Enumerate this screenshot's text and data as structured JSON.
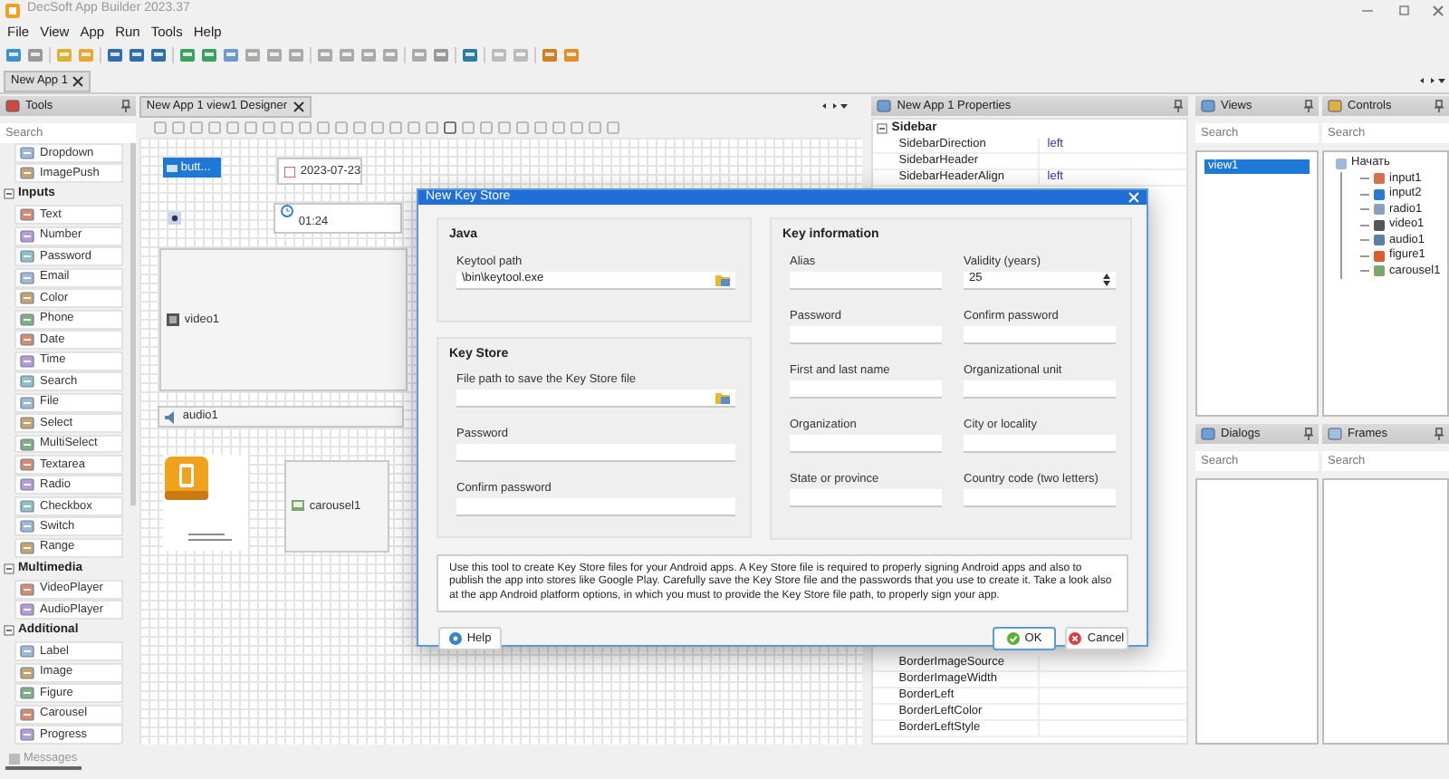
{
  "window": {
    "title": "DecSoft App Builder 2023.37"
  },
  "menu": [
    "File",
    "View",
    "App",
    "Run",
    "Tools",
    "Help"
  ],
  "document_tabs": [
    {
      "label": "New App 1",
      "selected": true
    }
  ],
  "tools_panel": {
    "title": "Tools",
    "search": {
      "placeholder": "Search"
    },
    "items": [
      {
        "kind": "item",
        "label": "Dropdown"
      },
      {
        "kind": "item",
        "label": "ImagePush"
      },
      {
        "kind": "group",
        "label": "Inputs",
        "expanded": true
      },
      {
        "kind": "item",
        "label": "Text"
      },
      {
        "kind": "item",
        "label": "Number"
      },
      {
        "kind": "item",
        "label": "Password"
      },
      {
        "kind": "item",
        "label": "Email"
      },
      {
        "kind": "item",
        "label": "Color"
      },
      {
        "kind": "item",
        "label": "Phone"
      },
      {
        "kind": "item",
        "label": "Date"
      },
      {
        "kind": "item",
        "label": "Time"
      },
      {
        "kind": "item",
        "label": "Search"
      },
      {
        "kind": "item",
        "label": "File"
      },
      {
        "kind": "item",
        "label": "Select"
      },
      {
        "kind": "item",
        "label": "MultiSelect"
      },
      {
        "kind": "item",
        "label": "Textarea"
      },
      {
        "kind": "item",
        "label": "Radio"
      },
      {
        "kind": "item",
        "label": "Checkbox"
      },
      {
        "kind": "item",
        "label": "Switch"
      },
      {
        "kind": "item",
        "label": "Range"
      },
      {
        "kind": "group",
        "label": "Multimedia",
        "expanded": true
      },
      {
        "kind": "item",
        "label": "VideoPlayer"
      },
      {
        "kind": "item",
        "label": "AudioPlayer"
      },
      {
        "kind": "group",
        "label": "Additional",
        "expanded": true
      },
      {
        "kind": "item",
        "label": "Label"
      },
      {
        "kind": "item",
        "label": "Image"
      },
      {
        "kind": "item",
        "label": "Figure"
      },
      {
        "kind": "item",
        "label": "Carousel"
      },
      {
        "kind": "item",
        "label": "Progress"
      }
    ]
  },
  "designer": {
    "tab": "New App 1 view1 Designer",
    "widgets": [
      {
        "kind": "button",
        "label": "butt...",
        "selected": true
      },
      {
        "kind": "date",
        "label": "2023-07-23"
      },
      {
        "kind": "radio"
      },
      {
        "kind": "time",
        "label": "01:24"
      },
      {
        "kind": "video",
        "label": "video1"
      },
      {
        "kind": "audio",
        "label": "audio1"
      },
      {
        "kind": "image"
      },
      {
        "kind": "carousel",
        "label": "carousel1"
      }
    ]
  },
  "properties": {
    "title": "New App 1 Properties",
    "group": {
      "label": "Sidebar",
      "expanded": true
    },
    "rows_top": [
      {
        "name": "SidebarDirection",
        "value": "left"
      },
      {
        "name": "SidebarHeader"
      },
      {
        "name": "SidebarHeaderAlign",
        "value": "left"
      }
    ],
    "rows_bottom": [
      {
        "name": "BorderImageSource"
      },
      {
        "name": "BorderImageWidth"
      },
      {
        "name": "BorderLeft"
      },
      {
        "name": "BorderLeftColor"
      },
      {
        "name": "BorderLeftStyle"
      }
    ]
  },
  "views": {
    "title": "Views",
    "search": {
      "placeholder": "Search"
    },
    "items": [
      {
        "label": "view1",
        "selected": true
      }
    ]
  },
  "controls": {
    "title": "Controls",
    "search": {
      "placeholder": "Search"
    },
    "tree": [
      {
        "label": "Начать",
        "kind": "view",
        "children": [
          {
            "label": "input1",
            "kind": "input"
          },
          {
            "label": "input2",
            "kind": "time"
          },
          {
            "label": "radio1",
            "kind": "radio"
          },
          {
            "label": "video1",
            "kind": "video"
          },
          {
            "label": "audio1",
            "kind": "audio"
          },
          {
            "label": "figure1",
            "kind": "figure"
          },
          {
            "label": "carousel1",
            "kind": "carousel"
          }
        ]
      }
    ]
  },
  "dialogs": {
    "title": "Dialogs",
    "search": {
      "placeholder": "Search"
    }
  },
  "frames": {
    "title": "Frames",
    "search": {
      "placeholder": "Search"
    }
  },
  "status_bar": {
    "tab": "Messages"
  },
  "dialog": {
    "title": "New Key Store",
    "java": {
      "title": "Java",
      "fields": [
        {
          "label": "Keytool path",
          "kind": "file",
          "value": "\\bin\\keytool.exe"
        }
      ]
    },
    "key_store": {
      "title": "Key Store",
      "fields": [
        {
          "label": "File path to save the Key Store file",
          "kind": "file"
        },
        {
          "label": "Password",
          "kind": "text"
        },
        {
          "label": "Confirm password",
          "kind": "text"
        }
      ]
    },
    "key_information": {
      "title": "Key information",
      "fields": [
        {
          "label": "Alias",
          "kind": "text"
        },
        {
          "label": "Validity (years)",
          "kind": "number",
          "value": "25"
        },
        {
          "label": "Password",
          "kind": "text"
        },
        {
          "label": "Confirm password",
          "kind": "text"
        },
        {
          "label": "First and last name",
          "kind": "text"
        },
        {
          "label": "Organizational unit",
          "kind": "text"
        },
        {
          "label": "Organization",
          "kind": "text"
        },
        {
          "label": "City or locality",
          "kind": "text"
        },
        {
          "label": "State or province",
          "kind": "text"
        },
        {
          "label": "Country code (two letters)",
          "kind": "text"
        }
      ]
    },
    "note": "Use this tool to create Key Store files for your Android apps. A Key Store file is required to properly signing Android apps and also to publish the app into stores like Google Play. Carefully save the Key Store file and the passwords that you use to create it. Take a look also at the app Android platform options, in which you must to provide the Key Store file path, to properly sign your app.",
    "buttons": [
      {
        "label": "Help",
        "kind": "help"
      },
      {
        "label": "OK",
        "kind": "ok"
      },
      {
        "label": "Cancel",
        "kind": "cancel"
      }
    ]
  }
}
